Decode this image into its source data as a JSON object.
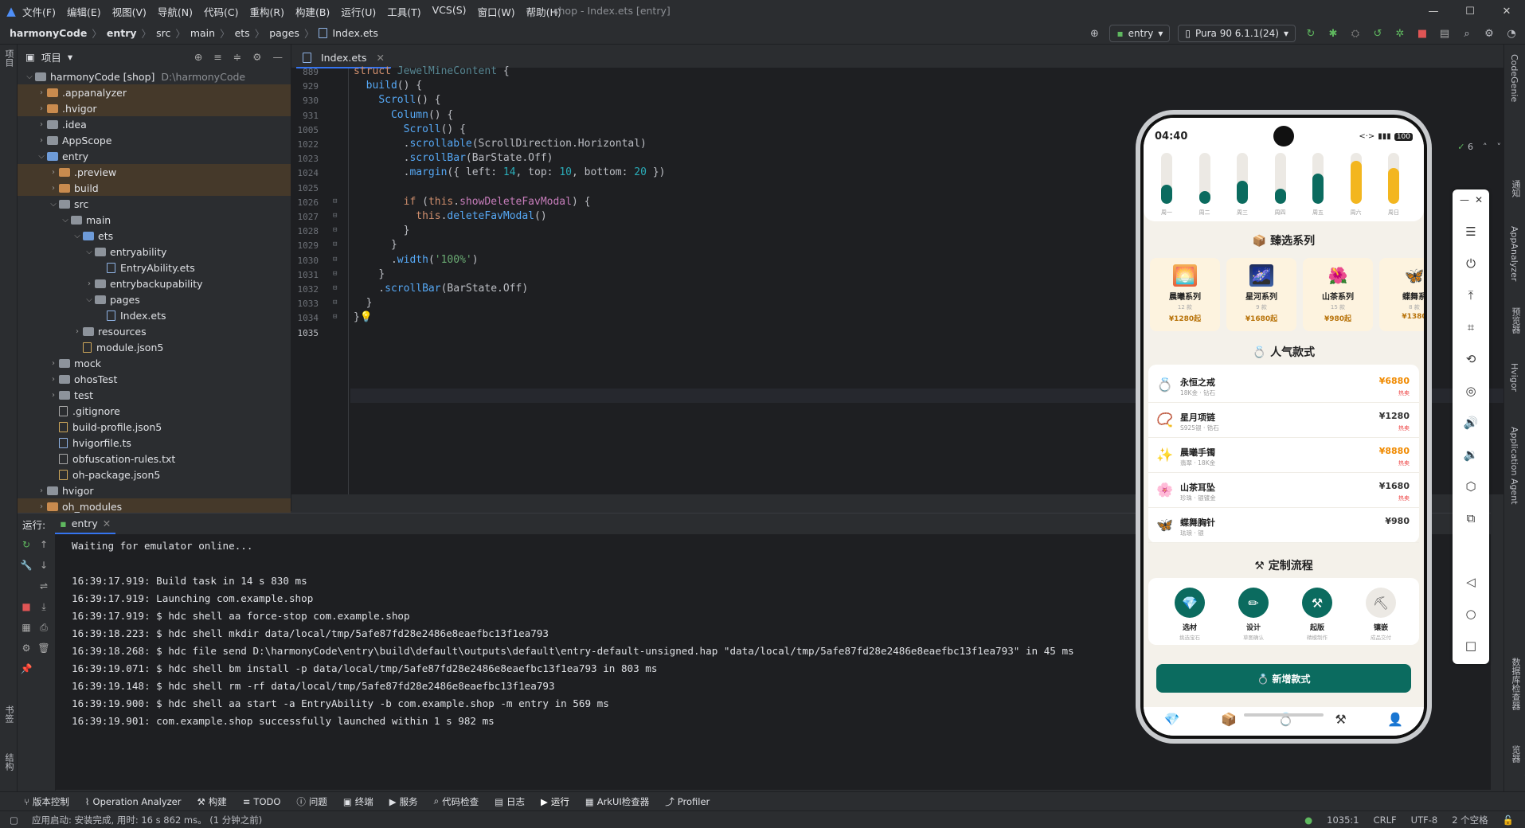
{
  "titlebar": {
    "menu": [
      "文件(F)",
      "编辑(E)",
      "视图(V)",
      "导航(N)",
      "代码(C)",
      "重构(R)",
      "构建(B)",
      "运行(U)",
      "工具(T)",
      "VCS(S)",
      "窗口(W)",
      "帮助(H)"
    ],
    "window_title": "shop - Index.ets [entry]"
  },
  "breadcrumbs": [
    "harmonyCode",
    "entry",
    "src",
    "main",
    "ets",
    "pages",
    "Index.ets"
  ],
  "toolbar": {
    "run_config": "entry",
    "device": "Pura 90 6.1.1(24)"
  },
  "left_stripe": {
    "project": "项目",
    "bookmarks": "书签",
    "structure": "结构"
  },
  "project_panel": {
    "title": "项目",
    "tree": [
      {
        "label": "harmonyCode [shop]",
        "dim": "D:\\harmonyCode",
        "depth": 0,
        "arrow": "open",
        "icon": "gray",
        "hl": false
      },
      {
        "label": ".appanalyzer",
        "depth": 1,
        "arrow": "closed",
        "icon": "orange",
        "hl": true
      },
      {
        "label": ".hvigor",
        "depth": 1,
        "arrow": "closed",
        "icon": "orange",
        "hl": true
      },
      {
        "label": ".idea",
        "depth": 1,
        "arrow": "closed",
        "icon": "gray",
        "hl": false
      },
      {
        "label": "AppScope",
        "depth": 1,
        "arrow": "closed",
        "icon": "gray",
        "hl": false
      },
      {
        "label": "entry",
        "depth": 1,
        "arrow": "open",
        "icon": "blue",
        "hl": false
      },
      {
        "label": ".preview",
        "depth": 2,
        "arrow": "closed",
        "icon": "orange",
        "hl": true
      },
      {
        "label": "build",
        "depth": 2,
        "arrow": "closed",
        "icon": "orange",
        "hl": true
      },
      {
        "label": "src",
        "depth": 2,
        "arrow": "open",
        "icon": "gray",
        "hl": false
      },
      {
        "label": "main",
        "depth": 3,
        "arrow": "open",
        "icon": "gray",
        "hl": false
      },
      {
        "label": "ets",
        "depth": 4,
        "arrow": "open",
        "icon": "blue",
        "hl": false
      },
      {
        "label": "entryability",
        "depth": 5,
        "arrow": "open",
        "icon": "gray",
        "hl": false
      },
      {
        "label": "EntryAbility.ets",
        "depth": 6,
        "arrow": "none",
        "icon": "file",
        "hl": false
      },
      {
        "label": "entrybackupability",
        "depth": 5,
        "arrow": "closed",
        "icon": "gray",
        "hl": false
      },
      {
        "label": "pages",
        "depth": 5,
        "arrow": "open",
        "icon": "gray",
        "hl": false
      },
      {
        "label": "Index.ets",
        "depth": 6,
        "arrow": "none",
        "icon": "file",
        "hl": false
      },
      {
        "label": "resources",
        "depth": 4,
        "arrow": "closed",
        "icon": "gray",
        "hl": false
      },
      {
        "label": "module.json5",
        "depth": 4,
        "arrow": "none",
        "icon": "json",
        "hl": false
      },
      {
        "label": "mock",
        "depth": 2,
        "arrow": "closed",
        "icon": "gray",
        "hl": false
      },
      {
        "label": "ohosTest",
        "depth": 2,
        "arrow": "closed",
        "icon": "gray",
        "hl": false
      },
      {
        "label": "test",
        "depth": 2,
        "arrow": "closed",
        "icon": "gray",
        "hl": false
      },
      {
        "label": ".gitignore",
        "depth": 2,
        "arrow": "none",
        "icon": "txt",
        "hl": false
      },
      {
        "label": "build-profile.json5",
        "depth": 2,
        "arrow": "none",
        "icon": "json",
        "hl": false
      },
      {
        "label": "hvigorfile.ts",
        "depth": 2,
        "arrow": "none",
        "icon": "file",
        "hl": false
      },
      {
        "label": "obfuscation-rules.txt",
        "depth": 2,
        "arrow": "none",
        "icon": "txt",
        "hl": false
      },
      {
        "label": "oh-package.json5",
        "depth": 2,
        "arrow": "none",
        "icon": "json",
        "hl": false
      },
      {
        "label": "hvigor",
        "depth": 1,
        "arrow": "closed",
        "icon": "gray",
        "hl": false
      },
      {
        "label": "oh_modules",
        "depth": 1,
        "arrow": "closed",
        "icon": "orange",
        "hl": true
      }
    ]
  },
  "editor": {
    "tab": "Index.ets",
    "line_numbers": [
      "889",
      "929",
      "930",
      "931",
      "1005",
      "1022",
      "1023",
      "1024",
      "1025",
      "1026",
      "1027",
      "1028",
      "1029",
      "1030",
      "1031",
      "1032",
      "1033",
      "1034",
      "1035"
    ],
    "problems_count": "6"
  },
  "run_panel": {
    "label": "运行:",
    "tab": "entry",
    "console": [
      "Waiting for emulator online...",
      "",
      "16:39:17.919: Build task in 14 s 830 ms",
      "16:39:17.919: Launching com.example.shop",
      "16:39:17.919: $ hdc shell aa force-stop com.example.shop",
      "16:39:18.223: $ hdc shell mkdir data/local/tmp/5afe87fd28e2486e8eaefbc13f1ea793",
      "16:39:18.268: $ hdc file send D:\\harmonyCode\\entry\\build\\default\\outputs\\default\\entry-default-unsigned.hap \"data/local/tmp/5afe87fd28e2486e8eaefbc13f1ea793\" in 45 ms",
      "16:39:19.071: $ hdc shell bm install -p data/local/tmp/5afe87fd28e2486e8eaefbc13f1ea793 in 803 ms",
      "16:39:19.148: $ hdc shell rm -rf data/local/tmp/5afe87fd28e2486e8eaefbc13f1ea793",
      "16:39:19.900: $ hdc shell aa start -a EntryAbility -b com.example.shop -m entry in 569 ms",
      "16:39:19.901: com.example.shop successfully launched within 1 s 982 ms"
    ]
  },
  "bottom_tabs": [
    "版本控制",
    "Operation Analyzer",
    "构建",
    "TODO",
    "问题",
    "终端",
    "服务",
    "代码检查",
    "日志",
    "运行",
    "ArkUI检查器",
    "Profiler"
  ],
  "status": {
    "message": "应用启动: 安装完成, 用时: 16 s 862 ms。 (1 分钟之前)",
    "position": "1035:1",
    "line_sep": "CRLF",
    "encoding": "UTF-8",
    "indent": "2 个空格"
  },
  "right_stripe": [
    "CodeGenie",
    "通知",
    "AppAnalyzer",
    "预览器",
    "Hvigor",
    "Application Agent",
    "数据库检查器",
    "设备文件浏览器"
  ],
  "phone": {
    "time": "04:40",
    "battery": "100",
    "week": [
      {
        "day": "周一",
        "level": 0.38,
        "color": "#0b6b5f"
      },
      {
        "day": "周二",
        "level": 0.25,
        "color": "#0b6b5f"
      },
      {
        "day": "周三",
        "level": 0.45,
        "color": "#0b6b5f"
      },
      {
        "day": "周四",
        "level": 0.3,
        "color": "#0b6b5f"
      },
      {
        "day": "周五",
        "level": 0.6,
        "color": "#0b6b5f"
      },
      {
        "day": "周六",
        "level": 0.85,
        "color": "#f3b61f"
      },
      {
        "day": "周日",
        "level": 0.7,
        "color": "#f3b61f"
      }
    ],
    "section_series": "📦 臻选系列",
    "series": [
      {
        "icon": "🌅",
        "name": "晨曦系列",
        "count": "12 款",
        "price": "¥1280起"
      },
      {
        "icon": "🌌",
        "name": "星河系列",
        "count": "9 款",
        "price": "¥1680起"
      },
      {
        "icon": "🌺",
        "name": "山茶系列",
        "count": "15 款",
        "price": "¥980起"
      },
      {
        "icon": "🦋",
        "name": "蝶舞系",
        "count": "8 款",
        "price": "¥1380"
      }
    ],
    "section_popular": "💍 人气款式",
    "popular": [
      {
        "icon": "💍",
        "name": "永恒之戒",
        "sub": "18K金 · 钻石",
        "price": "¥6880",
        "hot": "热卖",
        "price_color": "#f08a00"
      },
      {
        "icon": "📿",
        "name": "星月项链",
        "sub": "S925银 · 锆石",
        "price": "¥1280",
        "hot": "热卖",
        "price_color": "#333333"
      },
      {
        "icon": "✨",
        "name": "晨曦手镯",
        "sub": "翡翠 · 18K金",
        "price": "¥8880",
        "hot": "热卖",
        "price_color": "#f08a00"
      },
      {
        "icon": "🌸",
        "name": "山茶耳坠",
        "sub": "珍珠 · 银镀金",
        "price": "¥1680",
        "hot": "热卖",
        "price_color": "#333333"
      },
      {
        "icon": "🦋",
        "name": "蝶舞胸针",
        "sub": "珐琅 · 银",
        "price": "¥980",
        "hot": "",
        "price_color": "#333333"
      }
    ],
    "section_process": "⚒ 定制流程",
    "process": [
      {
        "icon": "💎",
        "name": "选材",
        "sub": "挑选宝石",
        "bg": "#0b6b5f"
      },
      {
        "icon": "✏",
        "name": "设计",
        "sub": "草图确认",
        "bg": "#0b6b5f"
      },
      {
        "icon": "⚒",
        "name": "起版",
        "sub": "精模制作",
        "bg": "#0b6b5f"
      },
      {
        "icon": "⛏",
        "name": "镶嵌",
        "sub": "成品交付",
        "bg": "#ece9e4"
      }
    ],
    "add_button": "💍 新增款式",
    "tabbar": [
      "💎",
      "📦",
      "💍",
      "⚒",
      "👤"
    ]
  }
}
